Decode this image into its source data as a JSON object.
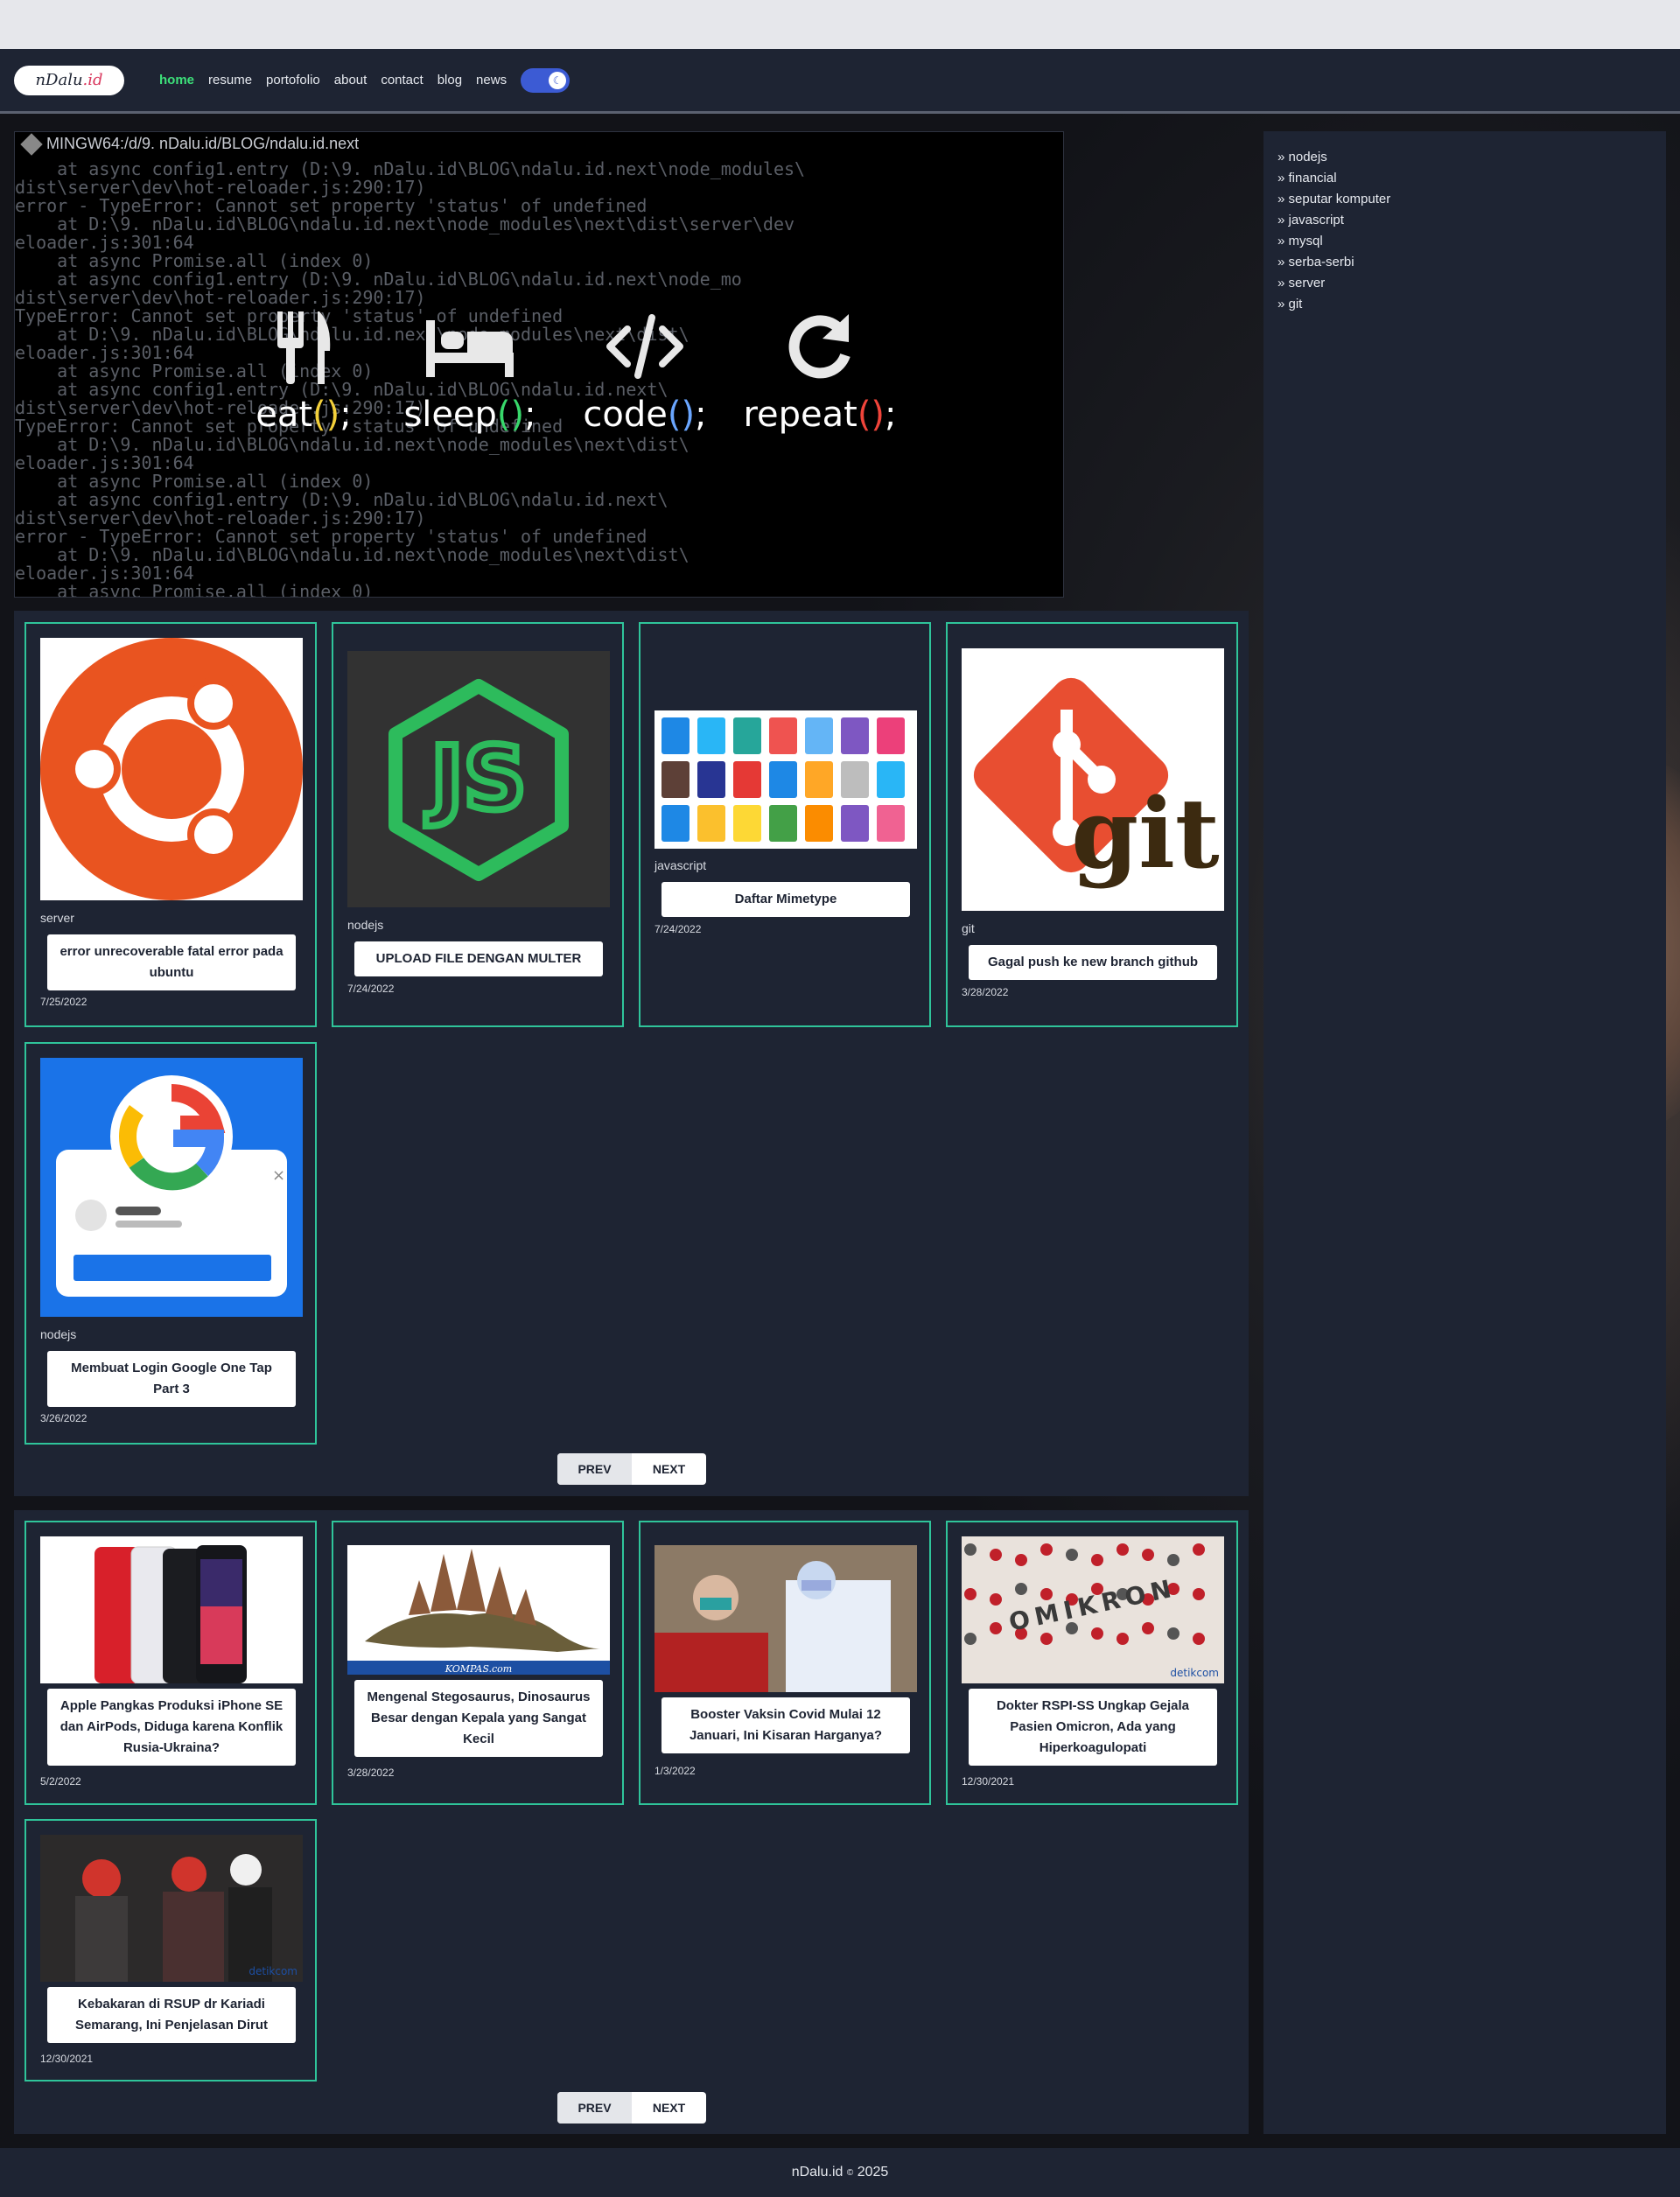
{
  "logo": {
    "text_main": "nDalu",
    "text_dot": ".id"
  },
  "nav": {
    "items": [
      {
        "label": "home",
        "active": true
      },
      {
        "label": "resume",
        "active": false
      },
      {
        "label": "portofolio",
        "active": false
      },
      {
        "label": "about",
        "active": false
      },
      {
        "label": "contact",
        "active": false
      },
      {
        "label": "blog",
        "active": false
      },
      {
        "label": "news",
        "active": false
      }
    ],
    "theme_toggle_icon": "moon-icon"
  },
  "hero": {
    "window_title": "MINGW64:/d/9. nDalu.id/BLOG/ndalu.id.next",
    "terminal_lines": [
      "    at async config1.entry (D:\\9. nDalu.id\\BLOG\\ndalu.id.next\\node_modules\\",
      "dist\\server\\dev\\hot-reloader.js:290:17)",
      "error - TypeError: Cannot set property 'status' of undefined",
      "    at D:\\9. nDalu.id\\BLOG\\ndalu.id.next\\node_modules\\next\\dist\\server\\dev",
      "eloader.js:301:64",
      "    at async Promise.all (index 0)",
      "    at async config1.entry (D:\\9. nDalu.id\\BLOG\\ndalu.id.next\\node_mo",
      "dist\\server\\dev\\hot-reloader.js:290:17)",
      "TypeError: Cannot set property 'status' of undefined",
      "    at D:\\9. nDalu.id\\BLOG\\ndalu.id.next\\node_modules\\next\\dist\\",
      "eloader.js:301:64",
      "    at async Promise.all (index 0)",
      "    at async config1.entry (D:\\9. nDalu.id\\BLOG\\ndalu.id.next\\",
      "dist\\server\\dev\\hot-reloader.js:290:17)",
      "TypeError: Cannot set property 'status' of undefined",
      "    at D:\\9. nDalu.id\\BLOG\\ndalu.id.next\\node_modules\\next\\dist\\",
      "eloader.js:301:64",
      "    at async Promise.all (index 0)",
      "    at async config1.entry (D:\\9. nDalu.id\\BLOG\\ndalu.id.next\\",
      "dist\\server\\dev\\hot-reloader.js:290:17)",
      "error - TypeError: Cannot set property 'status' of undefined",
      "    at D:\\9. nDalu.id\\BLOG\\ndalu.id.next\\node_modules\\next\\dist\\",
      "eloader.js:301:64",
      "    at async Promise.all (index 0)"
    ],
    "items": [
      {
        "icon": "fork-knife-icon",
        "glyph": "🍴",
        "word": "eat",
        "parens": "()",
        "paren_color": "y",
        "semi": ";"
      },
      {
        "icon": "bed-icon",
        "glyph": "🛏",
        "word": "sleep",
        "parens": "()",
        "paren_color": "g",
        "semi": ";"
      },
      {
        "icon": "code-icon",
        "glyph": "</>",
        "word": "code",
        "parens": "()",
        "paren_color": "b",
        "semi": ";"
      },
      {
        "icon": "redo-icon",
        "glyph": "↻",
        "word": "repeat",
        "parens": "()",
        "paren_color": "r",
        "semi": ";"
      }
    ]
  },
  "blog": {
    "posts": [
      {
        "category": "server",
        "title": "error unrecoverable fatal error pada ubuntu",
        "date": "7/25/2022",
        "image": "ubuntu-logo"
      },
      {
        "category": "nodejs",
        "title": "UPLOAD FILE DENGAN MULTER",
        "date": "7/24/2022",
        "image": "nodejs-logo"
      },
      {
        "category": "javascript",
        "title": "Daftar Mimetype",
        "date": "7/24/2022",
        "image": "file-type-icons"
      },
      {
        "category": "git",
        "title": "Gagal push ke new branch github",
        "date": "3/28/2022",
        "image": "git-logo"
      },
      {
        "category": "nodejs",
        "title": "Membuat Login Google One Tap Part 3",
        "date": "3/26/2022",
        "image": "google-one-tap"
      }
    ],
    "prev_label": "PREV",
    "next_label": "NEXT"
  },
  "news": {
    "posts": [
      {
        "title": "Apple Pangkas Produksi iPhone SE dan AirPods, Diduga karena Konflik Rusia-Ukraina?",
        "date": "5/2/2022",
        "image": "iphone-se-photo"
      },
      {
        "title": "Mengenal Stegosaurus, Dinosaurus Besar dengan Kepala yang Sangat Kecil",
        "date": "3/28/2022",
        "image": "stegosaurus-photo",
        "watermark": "KOMPAS.com"
      },
      {
        "title": "Booster Vaksin Covid Mulai 12 Januari, Ini Kisaran Harganya?",
        "date": "1/3/2022",
        "image": "vaccine-photo"
      },
      {
        "title": "Dokter RSPI-SS Ungkap Gejala Pasien Omicron, Ada yang Hiperkoagulopati",
        "date": "12/30/2021",
        "image": "omicron-photo",
        "watermark": "detikcom",
        "photo_text": "OMIKRON"
      },
      {
        "title": "Kebakaran di RSUP dr Kariadi Semarang, Ini Penjelasan Dirut",
        "date": "12/30/2021",
        "image": "fire-photo",
        "watermark": "detikcom"
      }
    ],
    "prev_label": "PREV",
    "next_label": "NEXT"
  },
  "sidebar": {
    "categories": [
      "» nodejs",
      "» financial",
      "» seputar komputer",
      "» javascript",
      "» mysql",
      "» serba-serbi",
      "» server",
      "» git"
    ]
  },
  "footer": {
    "brand": "nDalu.id",
    "copyright_symbol": "©",
    "year": "2025"
  },
  "colors": {
    "accent_green": "#2fc49a",
    "nav_active": "#3de07a",
    "toggle_blue": "#3c5bd4",
    "panel_bg": "#1e2433"
  }
}
